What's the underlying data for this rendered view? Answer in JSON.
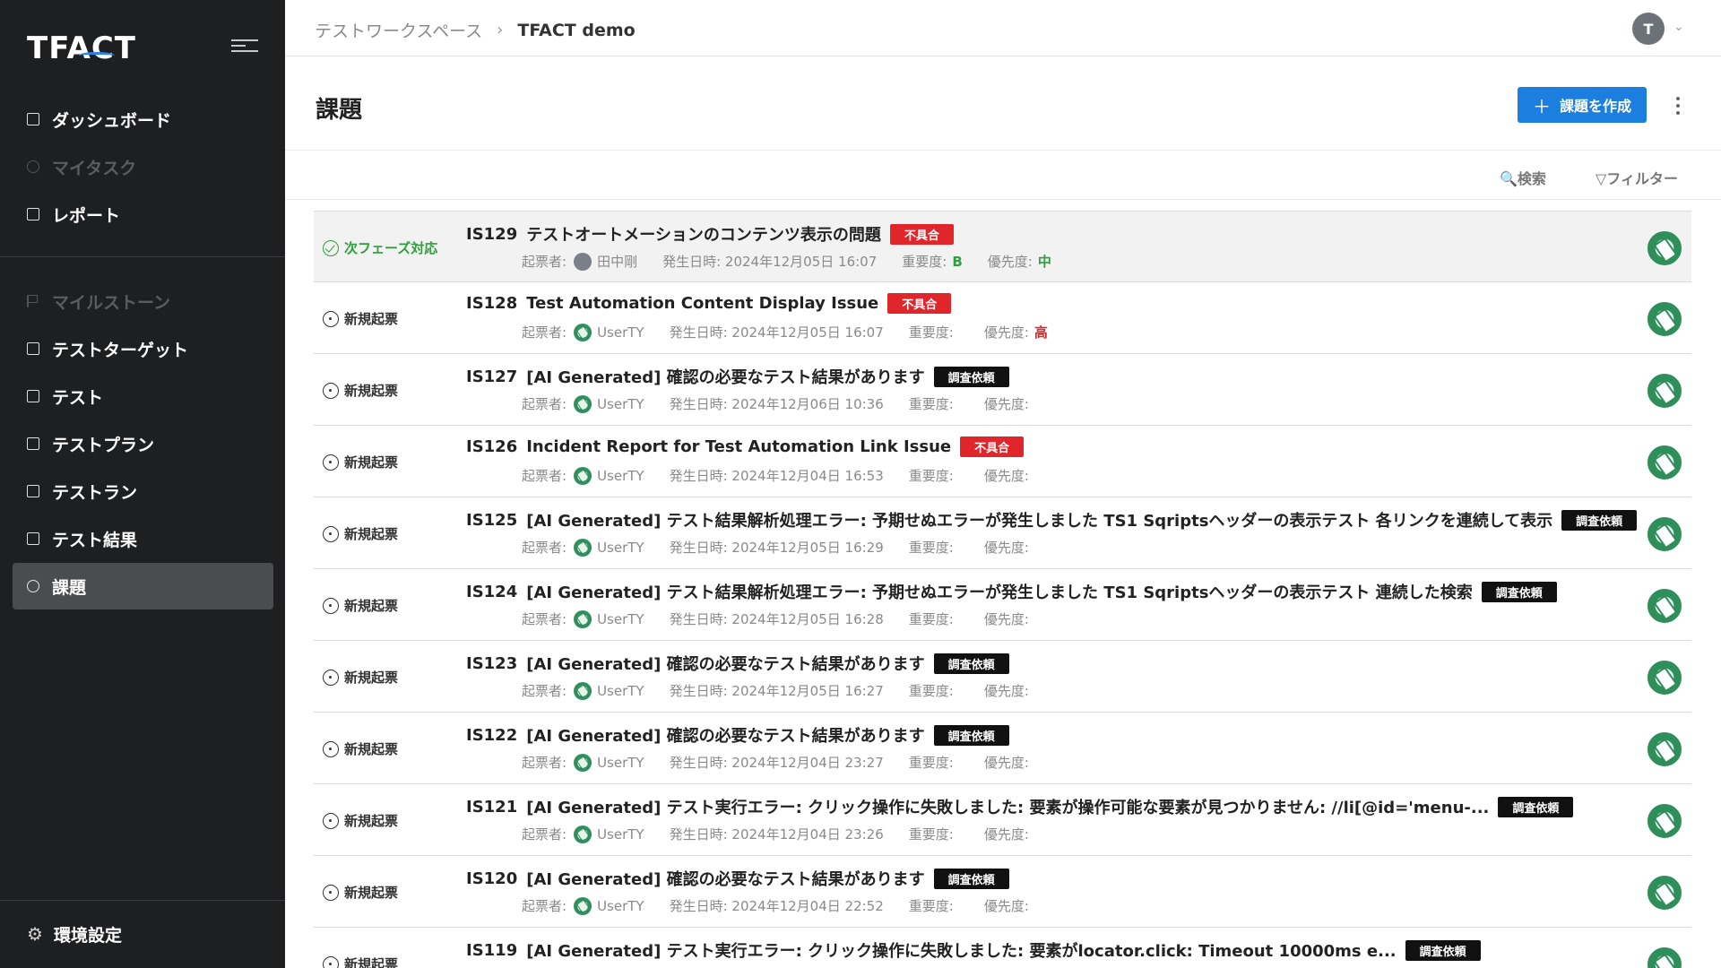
{
  "app": {
    "logo": "TFACT"
  },
  "sidebar": {
    "items": [
      {
        "label": "ダッシュボード",
        "icon": "dashboard-icon",
        "state": "normal"
      },
      {
        "label": "マイタスク",
        "icon": "check-circle-icon",
        "state": "disabled"
      },
      {
        "label": "レポート",
        "icon": "report-icon",
        "state": "normal"
      },
      {
        "label": "マイルストーン",
        "icon": "flag-icon",
        "state": "disabled"
      },
      {
        "label": "テストターゲット",
        "icon": "target-icon",
        "state": "normal"
      },
      {
        "label": "テスト",
        "icon": "test-icon",
        "state": "normal"
      },
      {
        "label": "テストプラン",
        "icon": "plan-icon",
        "state": "normal"
      },
      {
        "label": "テストラン",
        "icon": "run-icon",
        "state": "normal"
      },
      {
        "label": "テスト結果",
        "icon": "result-chart-icon",
        "state": "normal"
      },
      {
        "label": "課題",
        "icon": "issue-icon",
        "state": "active"
      }
    ],
    "settings_label": "環境設定"
  },
  "header": {
    "breadcrumb": {
      "workspace": "テストワークスペース",
      "separator": "›",
      "current": "TFACT demo"
    },
    "user_initial": "T"
  },
  "page": {
    "title": "課題",
    "create_button": "課題を作成",
    "create_icon": "＋",
    "search_label": "🔍検索",
    "filter_label": "▽フィルター"
  },
  "meta_labels": {
    "reporter": "起票者:",
    "date": "発生日時:",
    "severity": "重要度:",
    "priority": "優先度:"
  },
  "colors": {
    "accent": "#1c7fe0",
    "bug": "#e0262b",
    "next_phase": "#2e9e3e",
    "sidebar_bg": "#1e1f21"
  },
  "issues": [
    {
      "status": "次フェーズ対応",
      "id": "IS129",
      "title": "テストオートメーションのコンテンツ表示の問題",
      "tag": "不具合",
      "reporter": "田中剛",
      "date": "2024年12月05日 16:07",
      "severity": "B",
      "priority": "中"
    },
    {
      "status": "新規起票",
      "id": "IS128",
      "title": "Test Automation Content Display Issue",
      "tag": "不具合",
      "reporter": "UserTY",
      "date": "2024年12月05日 16:07",
      "severity": "",
      "priority": "高"
    },
    {
      "status": "新規起票",
      "id": "IS127",
      "title": "[AI Generated] 確認の必要なテスト結果があります",
      "tag": "調査依頼",
      "reporter": "UserTY",
      "date": "2024年12月06日 10:36",
      "severity": "",
      "priority": ""
    },
    {
      "status": "新規起票",
      "id": "IS126",
      "title": "Incident Report for Test Automation Link Issue",
      "tag": "不具合",
      "reporter": "UserTY",
      "date": "2024年12月04日 16:53",
      "severity": "",
      "priority": ""
    },
    {
      "status": "新規起票",
      "id": "IS125",
      "title": "[AI Generated] テスト結果解析処理エラー: 予期せぬエラーが発生しました TS1 Sqriptsヘッダーの表示テスト 各リンクを連続して表示",
      "tag": "調査依頼",
      "reporter": "UserTY",
      "date": "2024年12月05日 16:29",
      "severity": "",
      "priority": ""
    },
    {
      "status": "新規起票",
      "id": "IS124",
      "title": "[AI Generated] テスト結果解析処理エラー: 予期せぬエラーが発生しました TS1 Sqriptsヘッダーの表示テスト 連続した検索",
      "tag": "調査依頼",
      "reporter": "UserTY",
      "date": "2024年12月05日 16:28",
      "severity": "",
      "priority": ""
    },
    {
      "status": "新規起票",
      "id": "IS123",
      "title": "[AI Generated] 確認の必要なテスト結果があります",
      "tag": "調査依頼",
      "reporter": "UserTY",
      "date": "2024年12月05日 16:27",
      "severity": "",
      "priority": ""
    },
    {
      "status": "新規起票",
      "id": "IS122",
      "title": "[AI Generated] 確認の必要なテスト結果があります",
      "tag": "調査依頼",
      "reporter": "UserTY",
      "date": "2024年12月04日 23:27",
      "severity": "",
      "priority": ""
    },
    {
      "status": "新規起票",
      "id": "IS121",
      "title": "[AI Generated] テスト実行エラー: クリック操作に失敗しました: 要素が操作可能な要素が見つかりません: //li[@id='menu-...",
      "tag": "調査依頼",
      "reporter": "UserTY",
      "date": "2024年12月04日 23:26",
      "severity": "",
      "priority": ""
    },
    {
      "status": "新規起票",
      "id": "IS120",
      "title": "[AI Generated] 確認の必要なテスト結果があります",
      "tag": "調査依頼",
      "reporter": "UserTY",
      "date": "2024年12月04日 22:52",
      "severity": "",
      "priority": ""
    },
    {
      "status": "新規起票",
      "id": "IS119",
      "title": "[AI Generated] テスト実行エラー: クリック操作に失敗しました: 要素がlocator.click: Timeout 10000ms e...",
      "tag": "調査依頼",
      "reporter": "",
      "date": "",
      "severity": "",
      "priority": ""
    }
  ]
}
